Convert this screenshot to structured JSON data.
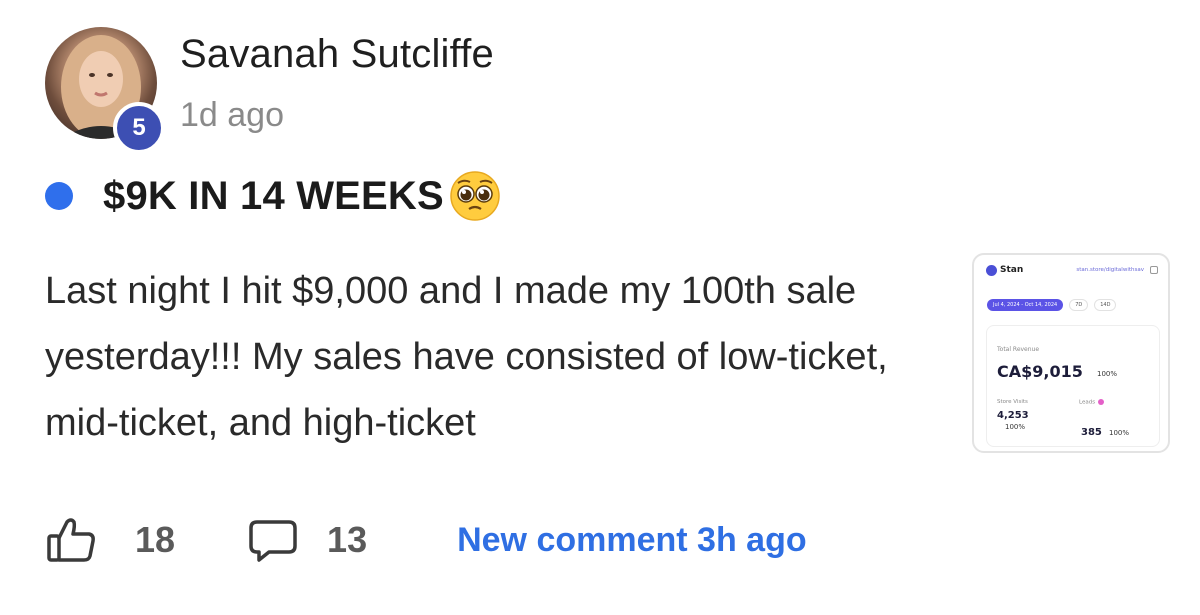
{
  "author": {
    "name": "Savanah Sutcliffe",
    "level": "5",
    "posted": "1d ago"
  },
  "post": {
    "title": "$9K IN 14 WEEKS",
    "title_emoji": "pleading-face-emoji",
    "body": "Last night I hit $9,000 and I made my 100th sale yesterday!!! My sales have consisted of low-ticket, mid-ticket, and high-ticket"
  },
  "attachment": {
    "brand": "Stan",
    "store_url": "stan.store/digitalwithsav",
    "date_range": "Jul 4, 2024 - Oct 14, 2024",
    "filter_7d": "7D",
    "filter_14d": "14D",
    "revenue_label": "Total Revenue",
    "revenue_value": "CA$9,015",
    "revenue_change": "100%",
    "visits_label": "Store Visits",
    "visits_value": "4,253",
    "visits_change": "100%",
    "leads_label": "Leads",
    "leads_value": "385",
    "leads_change": "100%"
  },
  "footer": {
    "likes": "18",
    "comments": "13",
    "new_comment": "New comment 3h ago"
  },
  "colors": {
    "accent_blue": "#2f6fe3",
    "unread_dot": "#2f6fec",
    "level_badge": "#3d4fb3"
  }
}
